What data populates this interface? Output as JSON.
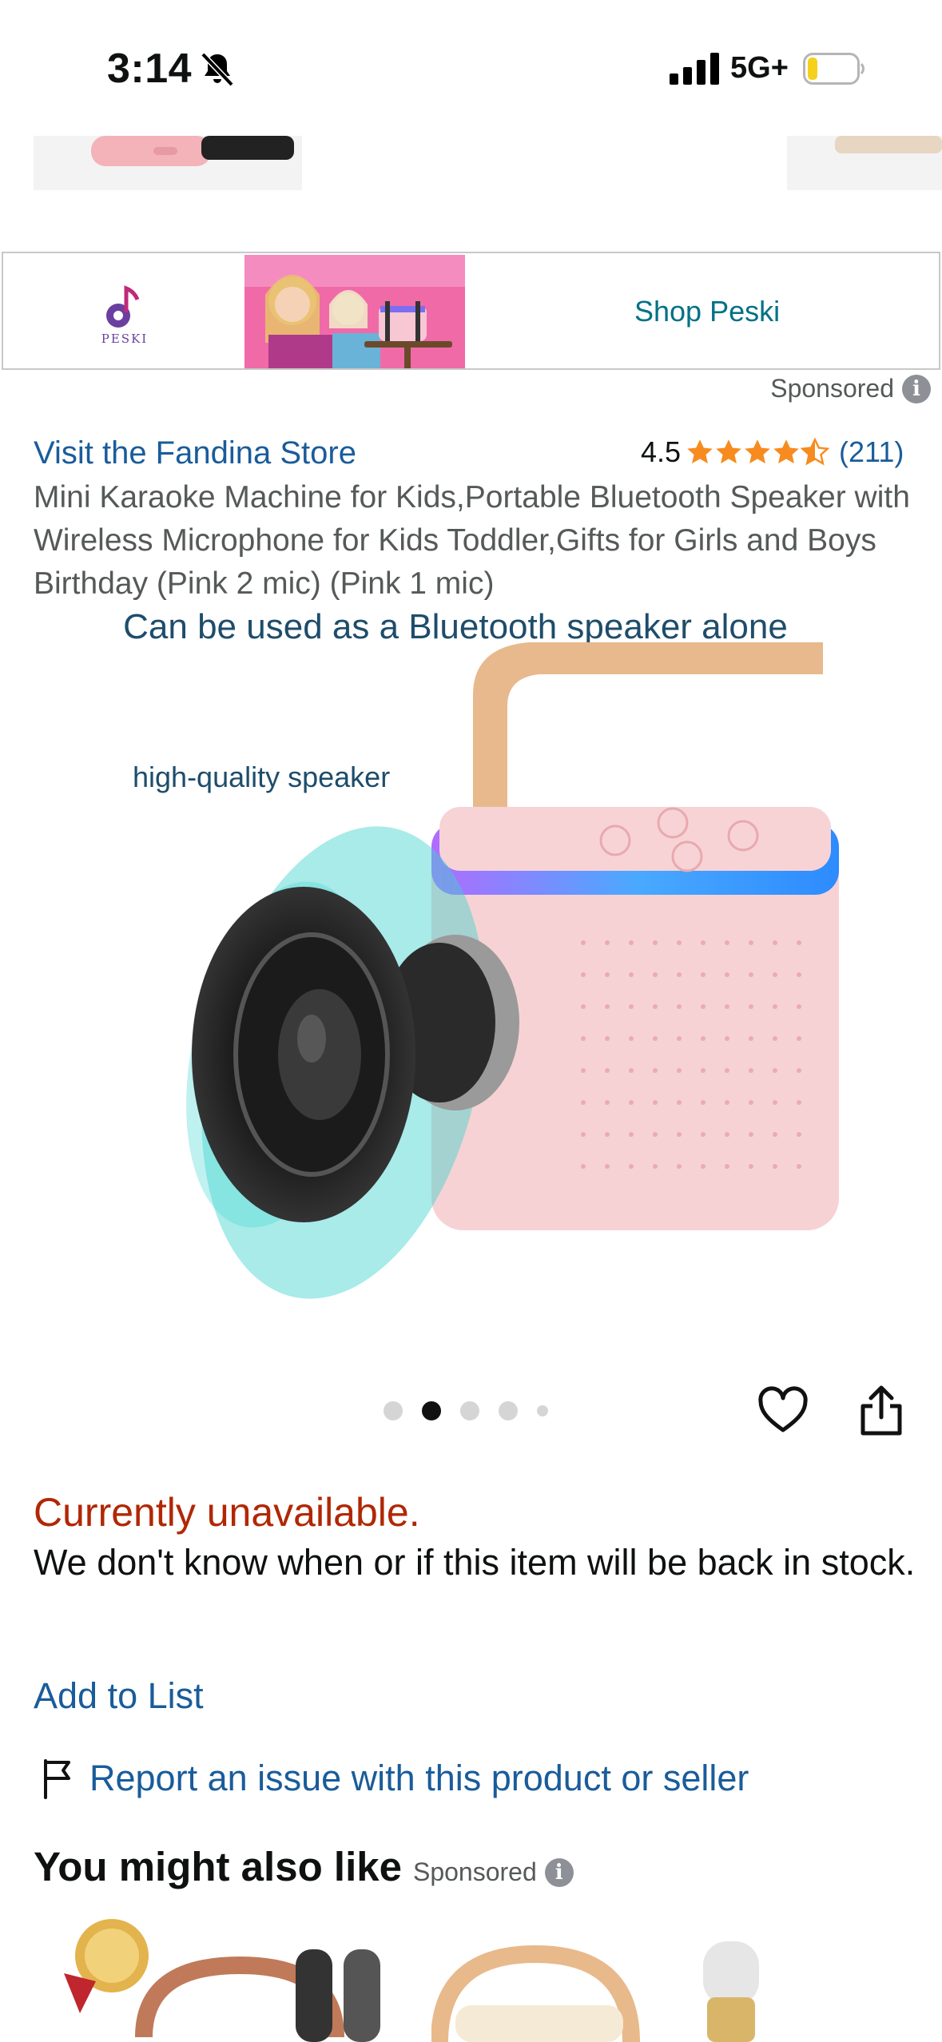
{
  "status_bar": {
    "time": "3:14",
    "network": "5G+"
  },
  "banner": {
    "brand_logo_text": "PESKI",
    "cta": "Shop Peski"
  },
  "sponsored_label": "Sponsored",
  "product": {
    "store_link": "Visit the Fandina Store",
    "rating_value": "4.5",
    "rating_count": "(211)",
    "stars": 4.5,
    "title": "Mini Karaoke Machine for Kids,Portable Bluetooth Speaker with Wireless Microphone for Kids Toddler,Gifts for Girls and Boys Birthday (Pink 2 mic) (Pink 1 mic)",
    "image_caption": "Can be used as a Bluetooth speaker alone",
    "image_subcaption": "high-quality speaker",
    "image_index": 2,
    "image_count": 5
  },
  "availability": {
    "status": "Currently unavailable.",
    "message": "We don't know when or if this item will be back in stock."
  },
  "actions": {
    "add_to_list": "Add to List",
    "report": "Report an issue with this product or seller"
  },
  "recommendations": {
    "title": "You might also like",
    "sponsored": "Sponsored"
  },
  "colors": {
    "link": "#1a5c9a",
    "teal_link": "#007185",
    "unavailable": "#b12704",
    "star": "#f78b1f"
  }
}
